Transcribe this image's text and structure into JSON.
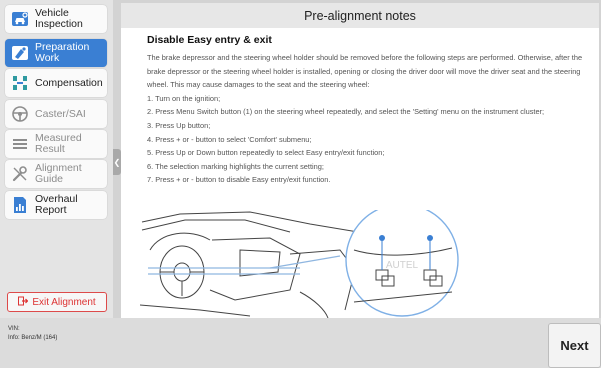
{
  "sidebar": {
    "items": [
      {
        "label": "Vehicle Inspection",
        "icon": "car-inspection-icon",
        "state": "normal"
      },
      {
        "label": "Preparation Work",
        "icon": "preparation-icon",
        "state": "active"
      },
      {
        "label": "Compensation",
        "icon": "compensation-icon",
        "state": "normal"
      },
      {
        "label": "Caster/SAI",
        "icon": "steering-wheel-icon",
        "state": "disabled"
      },
      {
        "label": "Measured Result",
        "icon": "list-icon",
        "state": "disabled"
      },
      {
        "label": "Alignment Guide",
        "icon": "wrench-icon",
        "state": "disabled"
      },
      {
        "label": "Overhaul Report",
        "icon": "report-icon",
        "state": "normal"
      }
    ],
    "exit_label": "Exit Alignment"
  },
  "content": {
    "title": "Pre-alignment notes",
    "heading": "Disable Easy entry & exit",
    "intro": "The brake depressor and the steering wheel holder should be removed before the following steps are performed. Otherwise, after the brake depressor or the steering wheel holder is installed, opening or closing the driver door will move the driver seat and the steering wheel. This may cause damages to the seat and the steering wheel:",
    "steps": [
      "1. Turn on the ignition;",
      "2. Press Menu Switch button (1) on the steering wheel repeatedly, and select the 'Setting' menu on the instrument cluster;",
      "3. Press Up button;",
      "4. Press + or - button to select 'Comfort' submenu;",
      "5. Press Up or Down button repeatedly to select Easy entry/exit function;",
      "6. The selection marking highlights the current setting;",
      "7. Press + or - button to disable Easy entry/exit function."
    ],
    "watermark": "AUTEL"
  },
  "footer": {
    "vin": "VIN:",
    "info": "Info: Benz/M (164)",
    "next_label": "Next"
  },
  "colors": {
    "accent": "#3a7fd3",
    "exit": "#dd3333",
    "text_gray": "#555555"
  }
}
